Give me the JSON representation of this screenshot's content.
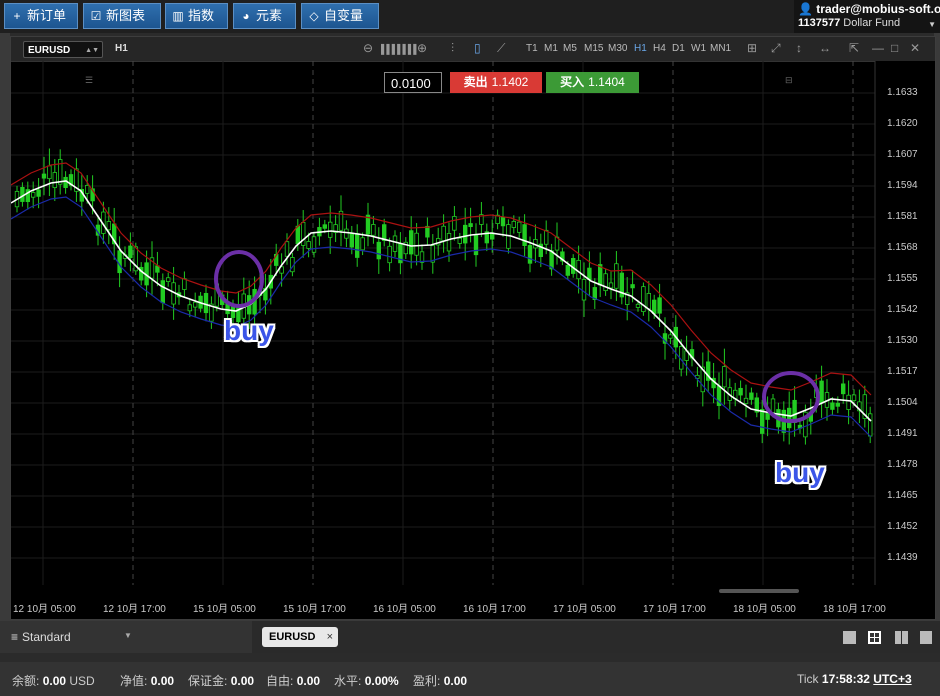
{
  "toolbar": {
    "new_order": "新订单",
    "new_chart": "新图表",
    "indicators": "指数",
    "elements": "元素",
    "variables": "自变量"
  },
  "account": {
    "user": "trader@mobius-soft.org",
    "number": "1137577",
    "fund": "Dollar Fund"
  },
  "chart": {
    "symbol": "EURUSD",
    "timeframe": "H1",
    "timeframes": [
      "T1",
      "M1",
      "M5",
      "M15",
      "M30",
      "H1",
      "H4",
      "D1",
      "W1",
      "MN1"
    ],
    "active_timeframe": "H1",
    "volume": "0.0100",
    "sell_label": "卖出",
    "sell_price": "1.1402",
    "buy_label": "买入",
    "buy_price": "1.1404",
    "price_labels": [
      "1.1633",
      "1.1620",
      "1.1607",
      "1.1594",
      "1.1581",
      "1.1568",
      "1.1555",
      "1.1542",
      "1.1530",
      "1.1517",
      "1.1504",
      "1.1491",
      "1.1478",
      "1.1465",
      "1.1452",
      "1.1439"
    ],
    "time_labels": [
      "12 10月 05:00",
      "12 10月 17:00",
      "15 10月 05:00",
      "15 10月 17:00",
      "16 10月 05:00",
      "16 10月 17:00",
      "17 10月 05:00",
      "17 10月 17:00",
      "18 10月 05:00",
      "18 10月 17:00"
    ],
    "annotation_1": "buy",
    "annotation_2": "buy",
    "colors": {
      "bull": "#22cc22",
      "upper_band": "#aa1111",
      "lower_band": "#1a2aa8",
      "middle_line": "#ffffff",
      "circle": "#6b2fa6"
    }
  },
  "tabs": {
    "workspace": "Standard",
    "symbol_tab": "EURUSD",
    "close_icon": "×"
  },
  "status": {
    "balance_label": "余额:",
    "balance": "0.00",
    "currency": "USD",
    "equity_label": "净值:",
    "equity": "0.00",
    "margin_label": "保证金:",
    "margin": "0.00",
    "free_label": "自由:",
    "free": "0.00",
    "level_label": "水平:",
    "level": "0.00%",
    "profit_label": "盈利:",
    "profit": "0.00",
    "tick_label": "Tick",
    "time": "17:58:32",
    "tz": "UTC+3"
  }
}
